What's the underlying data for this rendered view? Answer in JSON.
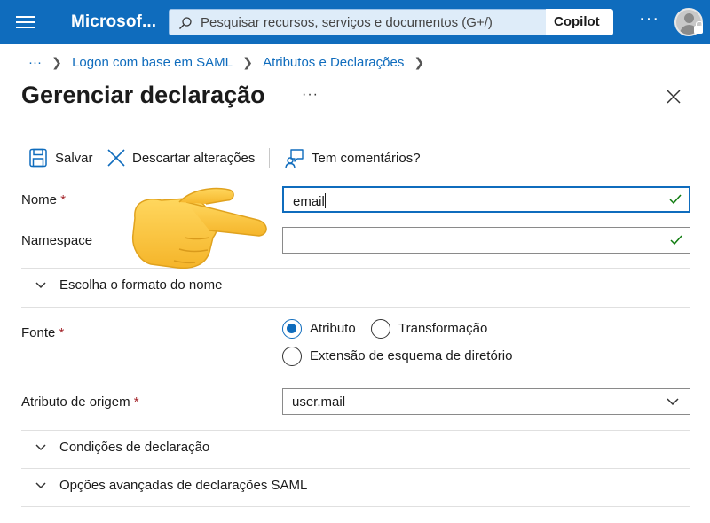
{
  "topbar": {
    "brand": "Microsof...",
    "search_placeholder": "Pesquisar recursos, serviços e documentos (G+/)",
    "copilot_label": "Copilot",
    "more_label": "···",
    "bg_color": "#0f6cbd"
  },
  "breadcrumb": {
    "overflow": "···",
    "items": [
      "Logon com base em SAML",
      "Atributos e Declarações"
    ]
  },
  "page": {
    "title": "Gerenciar declaração",
    "more_label": "···"
  },
  "toolbar": {
    "save_label": "Salvar",
    "discard_label": "Descartar alterações",
    "feedback_label": "Tem comentários?"
  },
  "form": {
    "name_label": "Nome",
    "name_value": "email",
    "namespace_label": "Namespace",
    "namespace_value": "",
    "required_mark": "*",
    "name_format_section": "Escolha o formato do nome",
    "source_label": "Fonte",
    "source_options": [
      "Atributo",
      "Transformação",
      "Extensão de esquema de diretório"
    ],
    "source_selected": "Atributo",
    "source_attribute_label": "Atributo de origem",
    "source_attribute_value": "user.mail",
    "conditions_section": "Condições de declaração",
    "advanced_section": "Opções avançadas de declarações SAML"
  },
  "icons": {
    "menu": "hamburger-icon",
    "search": "search-icon",
    "save": "save-icon",
    "discard": "close-icon",
    "feedback": "feedback-icon",
    "check": "checkmark-icon",
    "chevron": "chevron-down-icon",
    "pointer": "pointing-hand-icon"
  },
  "colors": {
    "accent": "#0f6cbd",
    "required": "#a4262c",
    "check": "#107c10",
    "hand": "#ffc83d"
  }
}
